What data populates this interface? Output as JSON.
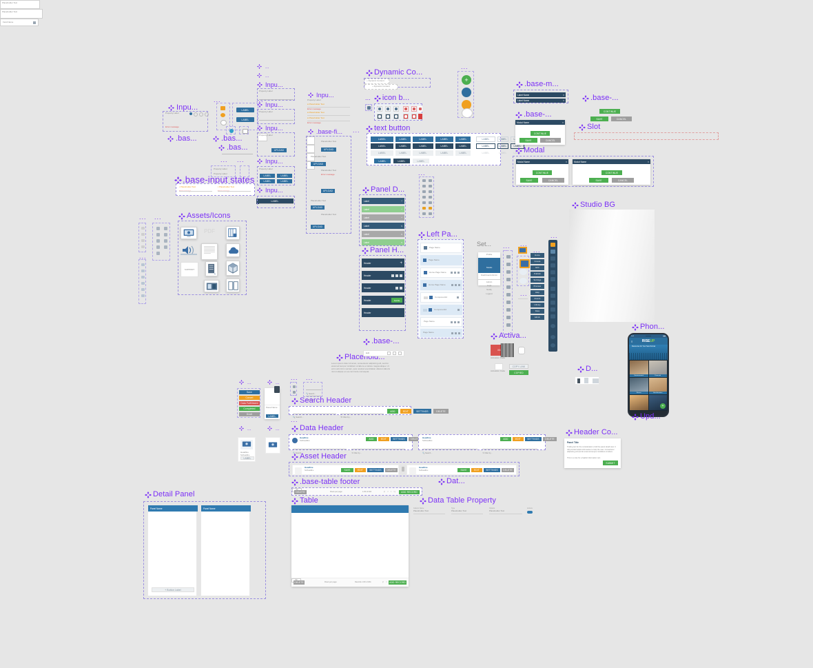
{
  "meta": {
    "canvas_background": "#e6e6e6",
    "label_color": "#7b2ff7",
    "accent_blue": "#2c4a63",
    "accent_green": "#4caf50",
    "accent_orange": "#f0a020",
    "accent_table_header": "#2f7ab0"
  },
  "labels": {
    "input_1": "Inpu...",
    "input_2": "Inpu...",
    "input_3": "Inpu...",
    "input_4": "Inpu...",
    "input_5": "Inpu...",
    "input_6": "Inpu...",
    "input_7": "Inpu...",
    "base_1": ".bas...",
    "base_2": ".bas...",
    "base_3": ".bas...",
    "base_4": ".bas...",
    "base_input_states": ".base-input states",
    "base_field": ".base-fi...",
    "assets_icons": "Assets/Icons",
    "dynamic_content": "Dynamic Co...",
    "icon_button": "icon b...",
    "text_button": "text button",
    "base_modal": ".base-m...",
    "base_dialog": ".base-...",
    "base_dialog_2": ".base-...",
    "slot": "Slot",
    "modal": "Modal",
    "panel_detail": "Panel D...",
    "panel_header": "Panel H...",
    "left_panel": "Left Pa...",
    "base_dots": ".base-...",
    "settings": "Set...",
    "activation": "Activa...",
    "studio_bg": "Studio BG",
    "phone": "Phon...",
    "device": "D...",
    "update": "Upd...",
    "placeholder": "Placehold...",
    "search_header": "Search Header",
    "data_header": "Data Header",
    "asset_header": "Asset Header",
    "base_table_footer": ".base-table footer",
    "data_short": "Dat...",
    "table": "Table",
    "data_table_property": "Data Table Property",
    "detail_panel": "Detail Panel",
    "header_component": "Header Co...",
    "ellipsis": "..."
  },
  "input_fields": {
    "property_label": "Property Label",
    "placeholder_text": "Placeholder Text",
    "helper_text": "Helper text",
    "error_text": "Error message",
    "select_one": "Select One",
    "upload": "UPLOAD",
    "required_mark": "*"
  },
  "dynamic_content": {
    "chip_1": "+ Dynamic Content",
    "chip_2": "+ Dynamic Content"
  },
  "text_button": {
    "label": "LABEL",
    "rows": [
      [
        "LABEL",
        "LABEL",
        "LABEL",
        "LABEL",
        "LABEL"
      ],
      [
        "LABEL",
        "LABEL",
        "LABEL",
        "LABEL",
        "LABEL"
      ],
      [
        "LABEL",
        "LABEL",
        "LABEL",
        "LABEL",
        "LABEL"
      ]
    ],
    "outline_rows": [
      [
        "LABEL",
        "LABEL",
        "LABEL",
        "LABEL"
      ],
      [
        "LABEL",
        "LABEL",
        "LABEL",
        "LABEL"
      ],
      [
        "LABEL",
        "LABEL",
        "LABEL",
        "LABEL"
      ]
    ],
    "bottom_row": [
      "LABEL",
      "LABEL",
      "LABEL"
    ]
  },
  "modal": {
    "title": "Modal Name",
    "label_title": "Label Name",
    "continue": "CONTINUE",
    "save": "SAVE",
    "cancel": "CANCEL",
    "close_icon": "×"
  },
  "panel": {
    "label": "Label",
    "header": "Header",
    "save": "SAVE"
  },
  "left_panel": {
    "items": [
      "Page Name",
      "Page Name",
      "Home Page Name",
      "Home Page Name",
      "ComponentId",
      "ComponentId",
      "Page Name",
      "Page Name"
    ]
  },
  "settings": {
    "menu": [
      "Profile",
      "Studio",
      "Dashboard Admin"
    ],
    "sub": [
      "Admin",
      "Logs",
      "Notify",
      "Logout"
    ]
  },
  "rail_buttons": [
    "Home",
    "Create",
    "Edit",
    "Publish",
    "Settings",
    "Preview",
    "Help",
    "Assets",
    "Library",
    "Data",
    "Admin"
  ],
  "activation": {
    "code_label": "Activation Code",
    "code": "XXX-XXX",
    "copy": "COPY LINK",
    "copied": "COPIED"
  },
  "phone_app": {
    "brand_pre": "RISE",
    "brand_post": "UP",
    "tagline": "Resources for Your New Normal",
    "tiles": [
      "Entertainment",
      "Financial",
      "Fitness",
      "Kids Activities",
      "Wellness",
      "Community"
    ]
  },
  "placeholder": {
    "body": "Lorem ipsum dolor sit amet, consectetur adipiscing elit, sed do eiusmod tempor incididunt ut labore et dolore magna aliqua. Ut enim ad minim veniam, quis nostrud exercitation ullamco laboris nisi ut aliquip ex ea commodo consequat.",
    "toolbar": [
      "Edit",
      "Link"
    ]
  },
  "search_header": {
    "search_placeholder": "Search...",
    "filter_placeholder": "Filter by...",
    "buttons": [
      "ADD",
      "EDIT",
      "SETTINGS",
      "DELETE"
    ]
  },
  "data_header": {
    "headline": "Headline",
    "subheadline": "Subheadline",
    "search_placeholder": "Search...",
    "filter_placeholder": "Filter by...",
    "buttons": [
      "ADD",
      "EDIT",
      "SETTINGS",
      "DELETE"
    ]
  },
  "asset_header": {
    "headline": "Headline",
    "subheadline": "Subheadline",
    "buttons": [
      "SAVE",
      "EDIT",
      "SETTINGS",
      "DELETE"
    ]
  },
  "table_footer": {
    "delete": "DELETE",
    "rows_per_page": "Rows per page:",
    "rows_value": "50",
    "record_count": "1-50 of 204",
    "add_record": "ADD RECORD",
    "pagination": [
      "|<",
      "<",
      ">",
      ">|"
    ]
  },
  "table": {
    "delete": "DELETE",
    "rows_per_page": "Rows per page:",
    "rows_value": "50",
    "record_count": "Records 1-50 of 204",
    "add_record": "ADD RECORD"
  },
  "data_table_property": {
    "fields": [
      {
        "label": "Column Name",
        "value": "Placeholder Text"
      },
      {
        "label": "Type",
        "value": "Placeholder Text"
      },
      {
        "label": "Options",
        "value": "Placeholder Text"
      },
      {
        "label": "Actions",
        "value": ""
      }
    ]
  },
  "data_field": {
    "value": "Field Name"
  },
  "detail_panel": {
    "panel_name": "Panel Name",
    "button": "+ Button Label"
  },
  "header_component": {
    "title": "Panel Title",
    "body": "Trailing text for the consideration of all the panel detail view. It will provide helpful information to help the user. Consectetur adipiscing elit sed do eiusmod tempor incididunt ut labore.",
    "footnote": "This is a note for a helpful information text.",
    "button": "SUBMIT"
  },
  "assets_icons": {
    "names": [
      "presentation",
      "pdf",
      "spreadsheet",
      "audio",
      "document",
      "cloud",
      "support",
      "server",
      "package",
      "media",
      "book"
    ],
    "pdf_label": "PDF",
    "support_label": "SUPPORT"
  },
  "misc_swatches": {
    "rows": [
      "Save",
      "Cancel",
      "Data Fulfillment",
      "Completed",
      "Draft"
    ]
  }
}
